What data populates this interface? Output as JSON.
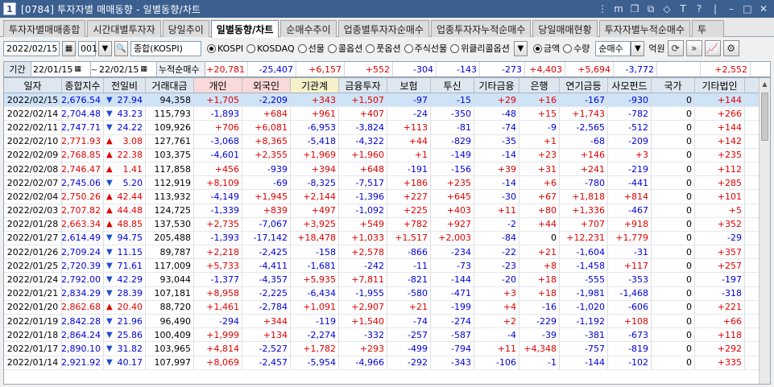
{
  "window": {
    "app_num": "1",
    "title": "[0784] 투자자별 매매동향 - 일별동향/차트",
    "controls": [
      "⋮",
      "m",
      "❐",
      "⧉",
      "◇",
      "T",
      "?",
      "|",
      "–",
      "□",
      "✕"
    ]
  },
  "tabs": [
    {
      "label": "투자자별매매종합",
      "active": false
    },
    {
      "label": "시간대별투자자",
      "active": false
    },
    {
      "label": "당일추이",
      "active": false
    },
    {
      "label": "일별동향/차트",
      "active": true
    },
    {
      "label": "순매수추이",
      "active": false
    },
    {
      "label": "업종별투자자순매수",
      "active": false
    },
    {
      "label": "업종투자자누적순매수",
      "active": false
    },
    {
      "label": "당일매매현황",
      "active": false
    },
    {
      "label": "투자자별누적순매수",
      "active": false
    },
    {
      "label": "투",
      "active": false
    }
  ],
  "toolbar": {
    "date": "2022/02/15",
    "market_code": "001",
    "market_name": "종합(KOSPI)",
    "market_options": [
      {
        "label": "KOSPI",
        "on": true
      },
      {
        "label": "KOSDAQ",
        "on": false
      },
      {
        "label": "선물",
        "on": false
      },
      {
        "label": "콜옵션",
        "on": false
      },
      {
        "label": "풋옵션",
        "on": false
      },
      {
        "label": "주식선물",
        "on": false
      },
      {
        "label": "위클리콜옵션",
        "on": false
      }
    ],
    "unit_options": [
      {
        "label": "금액",
        "on": true
      },
      {
        "label": "수량",
        "on": false
      }
    ],
    "mode": "순매수",
    "unit": "억원"
  },
  "summary": {
    "label": "기간",
    "from": "22/01/15",
    "sep": "~",
    "to": "22/02/15",
    "cum_label": "누적순매수",
    "values": [
      "+20,781",
      "-25,407",
      "+6,157",
      "+552",
      "-304",
      "-143",
      "-273",
      "+4,403",
      "+5,694",
      "-3,772",
      "",
      "+2,552"
    ]
  },
  "columns": [
    "일자",
    "종합지수",
    "전일비",
    "거래대금",
    "개인",
    "외국인",
    "기관계",
    "금융투자",
    "보험",
    "투신",
    "기타금융",
    "은행",
    "연기금등",
    "사모펀드",
    "국가",
    "기타법인"
  ],
  "rows": [
    {
      "date": "2022/02/15",
      "idx": "2,676.54",
      "dir": "down",
      "chg": "27.94",
      "vol": "94,358",
      "v": [
        "+1,705",
        "-2,209",
        "+343",
        "+1,507",
        "-97",
        "-15",
        "+29",
        "+16",
        "-167",
        "-930",
        "0",
        "+144"
      ]
    },
    {
      "date": "2022/02/14",
      "idx": "2,704.48",
      "dir": "down",
      "chg": "43.23",
      "vol": "115,793",
      "v": [
        "-1,893",
        "+684",
        "+961",
        "+407",
        "-24",
        "-350",
        "-48",
        "+15",
        "+1,743",
        "-782",
        "0",
        "+266"
      ]
    },
    {
      "date": "2022/02/11",
      "idx": "2,747.71",
      "dir": "down",
      "chg": "24.22",
      "vol": "109,926",
      "v": [
        "+706",
        "+6,081",
        "-6,953",
        "-3,824",
        "+113",
        "-81",
        "-74",
        "-9",
        "-2,565",
        "-512",
        "0",
        "+144"
      ]
    },
    {
      "date": "2022/02/10",
      "idx": "2,771.93",
      "dir": "up",
      "chg": "3.08",
      "vol": "127,761",
      "v": [
        "-3,068",
        "+8,365",
        "-5,418",
        "-4,322",
        "+44",
        "-829",
        "-35",
        "+1",
        "-68",
        "-209",
        "0",
        "+142"
      ]
    },
    {
      "date": "2022/02/09",
      "idx": "2,768.85",
      "dir": "up",
      "chg": "22.38",
      "vol": "103,375",
      "v": [
        "-4,601",
        "+2,355",
        "+1,969",
        "+1,960",
        "+1",
        "-149",
        "-14",
        "+23",
        "+146",
        "+3",
        "0",
        "+235"
      ]
    },
    {
      "date": "2022/02/08",
      "idx": "2,746.47",
      "dir": "up",
      "chg": "1.41",
      "vol": "117,858",
      "v": [
        "+456",
        "-939",
        "+394",
        "+648",
        "-191",
        "-156",
        "+39",
        "+31",
        "+241",
        "-219",
        "0",
        "+112"
      ]
    },
    {
      "date": "2022/02/07",
      "idx": "2,745.06",
      "dir": "down",
      "chg": "5.20",
      "vol": "112,919",
      "v": [
        "+8,109",
        "-69",
        "-8,325",
        "-7,517",
        "+186",
        "+235",
        "-14",
        "+6",
        "-780",
        "-441",
        "0",
        "+285"
      ]
    },
    {
      "date": "2022/02/04",
      "idx": "2,750.26",
      "dir": "up",
      "chg": "42.44",
      "vol": "113,932",
      "v": [
        "-4,149",
        "+1,945",
        "+2,144",
        "-1,396",
        "+227",
        "+645",
        "-30",
        "+67",
        "+1,818",
        "+814",
        "0",
        "+101"
      ]
    },
    {
      "date": "2022/02/03",
      "idx": "2,707.82",
      "dir": "up",
      "chg": "44.48",
      "vol": "124,725",
      "v": [
        "-1,339",
        "+839",
        "+497",
        "-1,092",
        "+225",
        "+403",
        "+11",
        "+80",
        "+1,336",
        "-467",
        "0",
        "+5"
      ]
    },
    {
      "date": "2022/01/28",
      "idx": "2,663.34",
      "dir": "up",
      "chg": "48.85",
      "vol": "137,530",
      "v": [
        "+2,735",
        "-7,067",
        "+3,925",
        "+549",
        "+782",
        "+927",
        "-2",
        "+44",
        "+707",
        "+918",
        "0",
        "+352"
      ]
    },
    {
      "date": "2022/01/27",
      "idx": "2,614.49",
      "dir": "down",
      "chg": "94.75",
      "vol": "205,488",
      "v": [
        "-1,393",
        "-17,142",
        "+18,478",
        "+1,033",
        "+1,517",
        "+2,003",
        "-84",
        "0",
        "+12,231",
        "+1,779",
        "0",
        "-29"
      ]
    },
    {
      "date": "2022/01/26",
      "idx": "2,709.24",
      "dir": "down",
      "chg": "11.15",
      "vol": "89,787",
      "v": [
        "+2,218",
        "-2,425",
        "-158",
        "+2,578",
        "-866",
        "-234",
        "-22",
        "+21",
        "-1,604",
        "-31",
        "0",
        "+357"
      ]
    },
    {
      "date": "2022/01/25",
      "idx": "2,720.39",
      "dir": "down",
      "chg": "71.61",
      "vol": "117,009",
      "v": [
        "+5,733",
        "-4,411",
        "-1,681",
        "-242",
        "-11",
        "-73",
        "-23",
        "+8",
        "-1,458",
        "+117",
        "0",
        "+257"
      ]
    },
    {
      "date": "2022/01/24",
      "idx": "2,792.00",
      "dir": "down",
      "chg": "42.29",
      "vol": "93,044",
      "v": [
        "-1,377",
        "-4,357",
        "+5,935",
        "+7,811",
        "-821",
        "-144",
        "-20",
        "+18",
        "-555",
        "-353",
        "0",
        "-197"
      ]
    },
    {
      "date": "2022/01/21",
      "idx": "2,834.29",
      "dir": "down",
      "chg": "28.39",
      "vol": "107,181",
      "v": [
        "+8,958",
        "-2,225",
        "-6,434",
        "-1,955",
        "-580",
        "-471",
        "+3",
        "+18",
        "-1,981",
        "-1,468",
        "0",
        "-318"
      ]
    },
    {
      "date": "2022/01/20",
      "idx": "2,862.68",
      "dir": "up",
      "chg": "20.40",
      "vol": "88,720",
      "v": [
        "+1,461",
        "-2,784",
        "+1,091",
        "+2,907",
        "+21",
        "-199",
        "+4",
        "-16",
        "-1,020",
        "-606",
        "0",
        "+221"
      ]
    },
    {
      "date": "2022/01/19",
      "idx": "2,842.28",
      "dir": "down",
      "chg": "21.96",
      "vol": "96,490",
      "v": [
        "-294",
        "+344",
        "-119",
        "+1,540",
        "-74",
        "-274",
        "+2",
        "-229",
        "-1,192",
        "+108",
        "0",
        "+66"
      ]
    },
    {
      "date": "2022/01/18",
      "idx": "2,864.24",
      "dir": "down",
      "chg": "25.86",
      "vol": "100,409",
      "v": [
        "+1,999",
        "+134",
        "-2,274",
        "-332",
        "-257",
        "-587",
        "-4",
        "-39",
        "-381",
        "-673",
        "0",
        "+118"
      ]
    },
    {
      "date": "2022/01/17",
      "idx": "2,890.10",
      "dir": "down",
      "chg": "31.82",
      "vol": "103,965",
      "v": [
        "+4,814",
        "-2,527",
        "+1,782",
        "+293",
        "-499",
        "-794",
        "+11",
        "+4,348",
        "-757",
        "-819",
        "0",
        "+292"
      ]
    },
    {
      "date": "2022/01/14",
      "idx": "2,921.92",
      "dir": "down",
      "chg": "40.17",
      "vol": "107,997",
      "v": [
        "+8,069",
        "-2,457",
        "-5,954",
        "-4,966",
        "-292",
        "-343",
        "-106",
        "-1",
        "-144",
        "-102",
        "0",
        "+335"
      ]
    }
  ]
}
